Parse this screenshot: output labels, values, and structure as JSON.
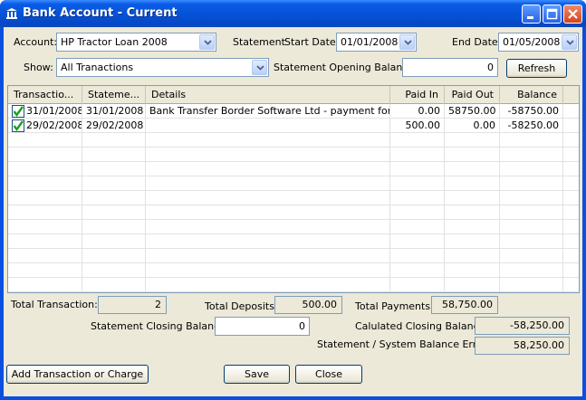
{
  "window": {
    "title": "Bank Account - Current",
    "icon": "bank-icon"
  },
  "filters": {
    "account_label": "Account:",
    "account_value": "HP Tractor Loan 2008",
    "statement_label": "Statement",
    "start_date_label": "Start Date:",
    "start_date_value": "01/01/2008",
    "end_date_label": "End Date:",
    "end_date_value": "01/05/2008",
    "show_label": "Show:",
    "show_value": "All Tranactions",
    "opening_balance_label": "Statement Opening Balance:",
    "opening_balance_value": "0",
    "refresh_label": "Refresh"
  },
  "table": {
    "columns": [
      "Transactio...",
      "Stateme...",
      "Details",
      "Paid In",
      "Paid Out",
      "Balance"
    ],
    "rows": [
      {
        "reconciled": true,
        "transaction_date": "31/01/2008",
        "statement_date": "31/01/2008",
        "details": "Bank Transfer Border Software Ltd - payment for g...",
        "paid_in": "0.00",
        "paid_out": "58750.00",
        "balance": "-58750.00"
      },
      {
        "reconciled": true,
        "transaction_date": "29/02/2008",
        "statement_date": "29/02/2008",
        "details": "",
        "paid_in": "500.00",
        "paid_out": "0.00",
        "balance": "-58250.00"
      }
    ]
  },
  "summary": {
    "total_transaction_label": "Total Transaction:",
    "total_transaction_value": "2",
    "total_deposits_label": "Total Deposits:",
    "total_deposits_value": "500.00",
    "total_payments_label": "Total Payments:",
    "total_payments_value": "58,750.00",
    "closing_balance_label": "Statement Closing Balance:",
    "closing_balance_value": "0",
    "calculated_closing_label": "Calulated Closing Balance:",
    "calculated_closing_value": "-58,250.00",
    "balance_error_label": "Statement / System Balance Error:",
    "balance_error_value": "58,250.00"
  },
  "buttons": {
    "add_transaction": "Add Transaction or Charge",
    "save": "Save",
    "close": "Close"
  },
  "colors": {
    "titlebar": "#0653d8",
    "client": "#ece9d8",
    "check": "#1aa01a"
  }
}
